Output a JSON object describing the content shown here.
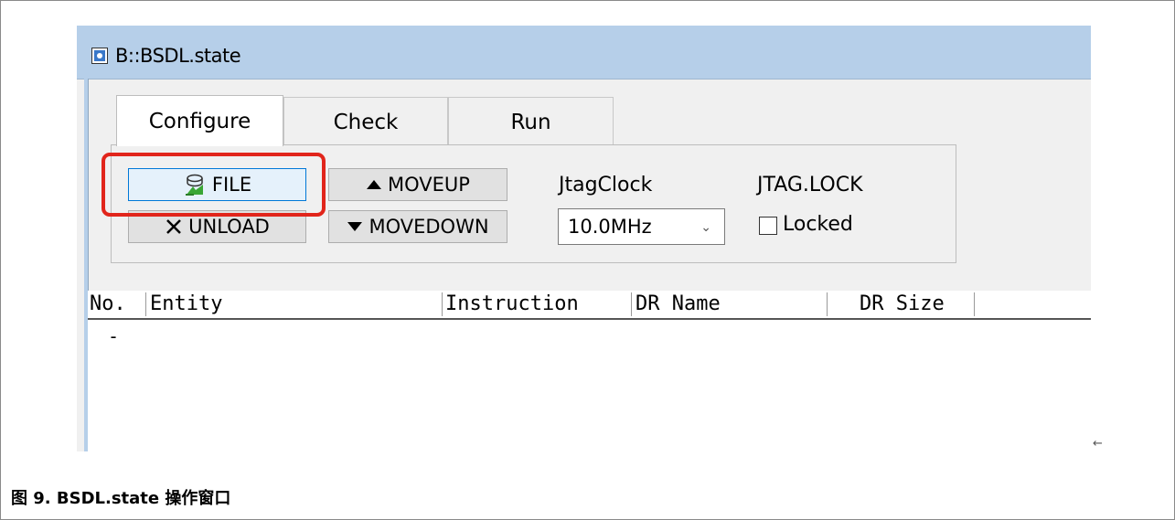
{
  "window": {
    "title": "B::BSDL.state",
    "icon": "app-window-icon"
  },
  "tabs": [
    {
      "label": "Configure",
      "active": true
    },
    {
      "label": "Check",
      "active": false
    },
    {
      "label": "Run",
      "active": false
    }
  ],
  "buttons": {
    "file": {
      "label": "FILE",
      "icon": "file-load-icon"
    },
    "unload": {
      "label": "UNLOAD",
      "icon": "x-icon"
    },
    "moveup": {
      "label": "MOVEUP",
      "icon": "triangle-up-icon"
    },
    "movedown": {
      "label": "MOVEDOWN",
      "icon": "triangle-down-icon"
    }
  },
  "jtag_clock": {
    "label": "JtagClock",
    "value": "10.0MHz"
  },
  "jtag_lock": {
    "label": "JTAG.LOCK",
    "checkbox_label": "Locked",
    "checked": false
  },
  "table": {
    "columns": [
      "No.",
      "Entity",
      "Instruction",
      "DR Name",
      "DR Size"
    ],
    "rows": [
      {
        "no": "-"
      }
    ]
  },
  "highlight_color": "#e1251b",
  "caption": "图 9. BSDL.state 操作窗口",
  "stray_mark": "←"
}
